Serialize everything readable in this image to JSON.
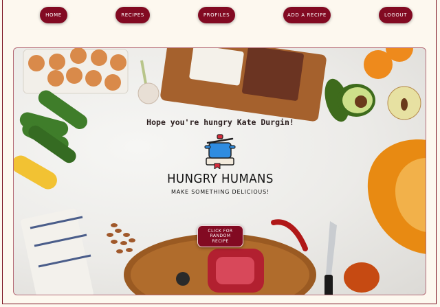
{
  "nav": {
    "home": "HOME",
    "recipes": "RECIPES",
    "profiles": "PROFILES",
    "add_recipe": "ADD A RECIPE",
    "logout": "LOGOUT"
  },
  "hero": {
    "greeting": "Hope you're hungry Kate Durgin!",
    "brand_title": "HUNGRY HUMANS",
    "brand_tagline": "MAKE SOMETHING DELICIOUS!",
    "random_button": "CLICK FOR RANDOM RECIPE"
  },
  "colors": {
    "accent": "#820a22",
    "background": "#fdf8ef"
  },
  "icons": [
    "cooking-pot-book-logo"
  ]
}
